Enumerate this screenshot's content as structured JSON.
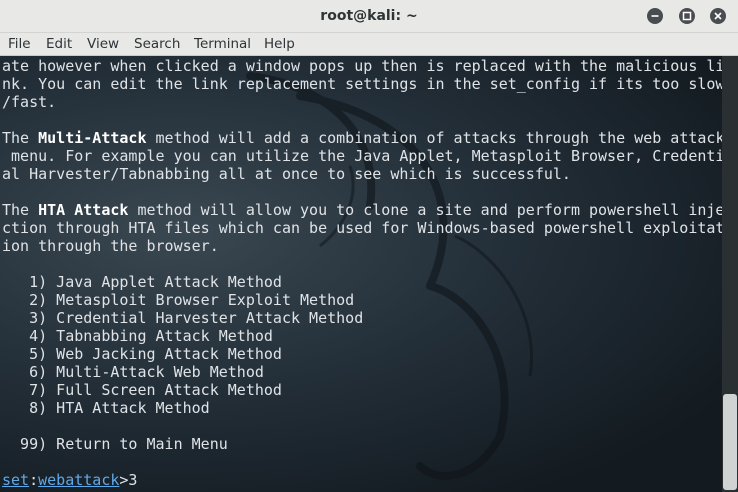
{
  "window": {
    "title": "root@kali: ~"
  },
  "menu": [
    "File",
    "Edit",
    "View",
    "Search",
    "Terminal",
    "Help"
  ],
  "terminal": {
    "lines": [
      [
        {
          "t": "ate however when clicked a window pops up then is replaced with the malicious li"
        }
      ],
      [
        {
          "t": "nk. You can edit the link replacement settings in the set_config if its too slow"
        }
      ],
      [
        {
          "t": "/fast."
        }
      ],
      [
        {
          "t": ""
        }
      ],
      [
        {
          "t": "The "
        },
        {
          "t": "Multi-Attack",
          "s": "b"
        },
        {
          "t": " method will add a combination of attacks through the web attack"
        }
      ],
      [
        {
          "t": " menu. For example you can utilize the Java Applet, Metasploit Browser, Credenti"
        }
      ],
      [
        {
          "t": "al Harvester/Tabnabbing all at once to see which is successful."
        }
      ],
      [
        {
          "t": ""
        }
      ],
      [
        {
          "t": "The "
        },
        {
          "t": "HTA Attack",
          "s": "b"
        },
        {
          "t": " method will allow you to clone a site and perform powershell inje"
        }
      ],
      [
        {
          "t": "ction through HTA files which can be used for Windows-based powershell exploitat"
        }
      ],
      [
        {
          "t": "ion through the browser."
        }
      ],
      [
        {
          "t": ""
        }
      ],
      [
        {
          "t": "   1) Java Applet Attack Method"
        }
      ],
      [
        {
          "t": "   2) Metasploit Browser Exploit Method"
        }
      ],
      [
        {
          "t": "   3) Credential Harvester Attack Method"
        }
      ],
      [
        {
          "t": "   4) Tabnabbing Attack Method"
        }
      ],
      [
        {
          "t": "   5) Web Jacking Attack Method"
        }
      ],
      [
        {
          "t": "   6) Multi-Attack Web Method"
        }
      ],
      [
        {
          "t": "   7) Full Screen Attack Method"
        }
      ],
      [
        {
          "t": "   8) HTA Attack Method"
        }
      ],
      [
        {
          "t": ""
        }
      ],
      [
        {
          "t": "  99) Return to Main Menu"
        }
      ],
      [
        {
          "t": ""
        }
      ],
      [
        {
          "t": "set",
          "s": "u"
        },
        {
          "t": ":"
        },
        {
          "t": "webattack",
          "s": "u"
        },
        {
          "t": ">3"
        }
      ]
    ]
  },
  "colors": {
    "titlebar": "#e8e8e7",
    "terminal_text": "#dfe3e6",
    "prompt": "#5fa8e8"
  }
}
